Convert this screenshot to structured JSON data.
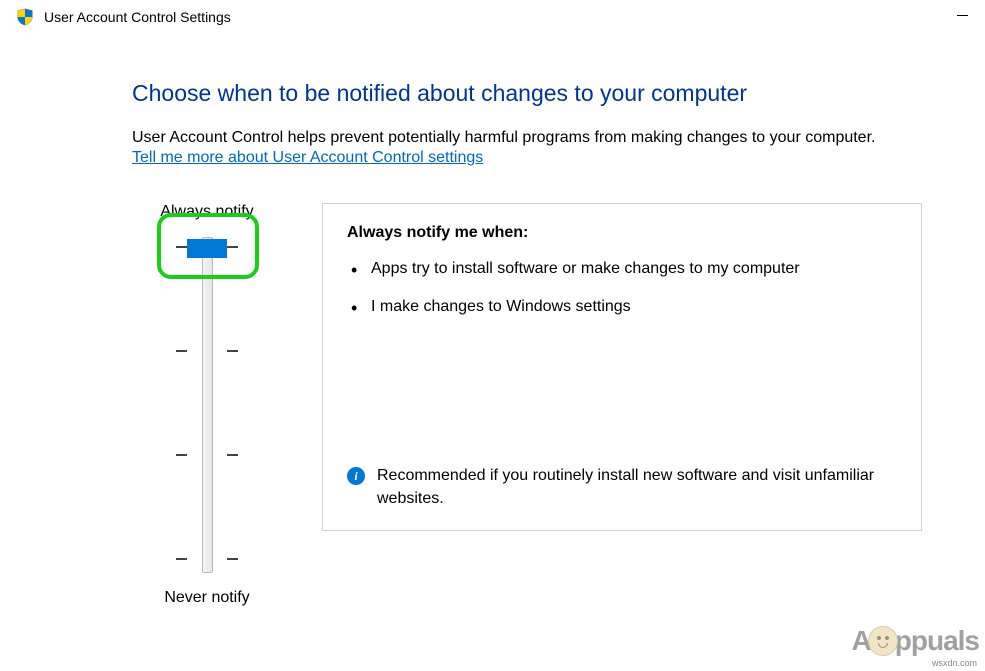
{
  "window": {
    "title": "User Account Control Settings"
  },
  "heading": "Choose when to be notified about changes to your computer",
  "description": "User Account Control helps prevent potentially harmful programs from making changes to your computer.",
  "link_text": "Tell me more about User Account Control settings",
  "slider": {
    "top_label": "Always notify",
    "bottom_label": "Never notify",
    "position": 0,
    "levels": 4
  },
  "detail": {
    "title": "Always notify me when:",
    "bullets": [
      "Apps try to install software or make changes to my computer",
      "I make changes to Windows settings"
    ],
    "info_glyph": "i",
    "recommendation": "Recommended if you routinely install new software and visit unfamiliar websites."
  },
  "watermark": {
    "prefix": "A",
    "suffix": "ppuals",
    "source": "wsxdn.com"
  }
}
